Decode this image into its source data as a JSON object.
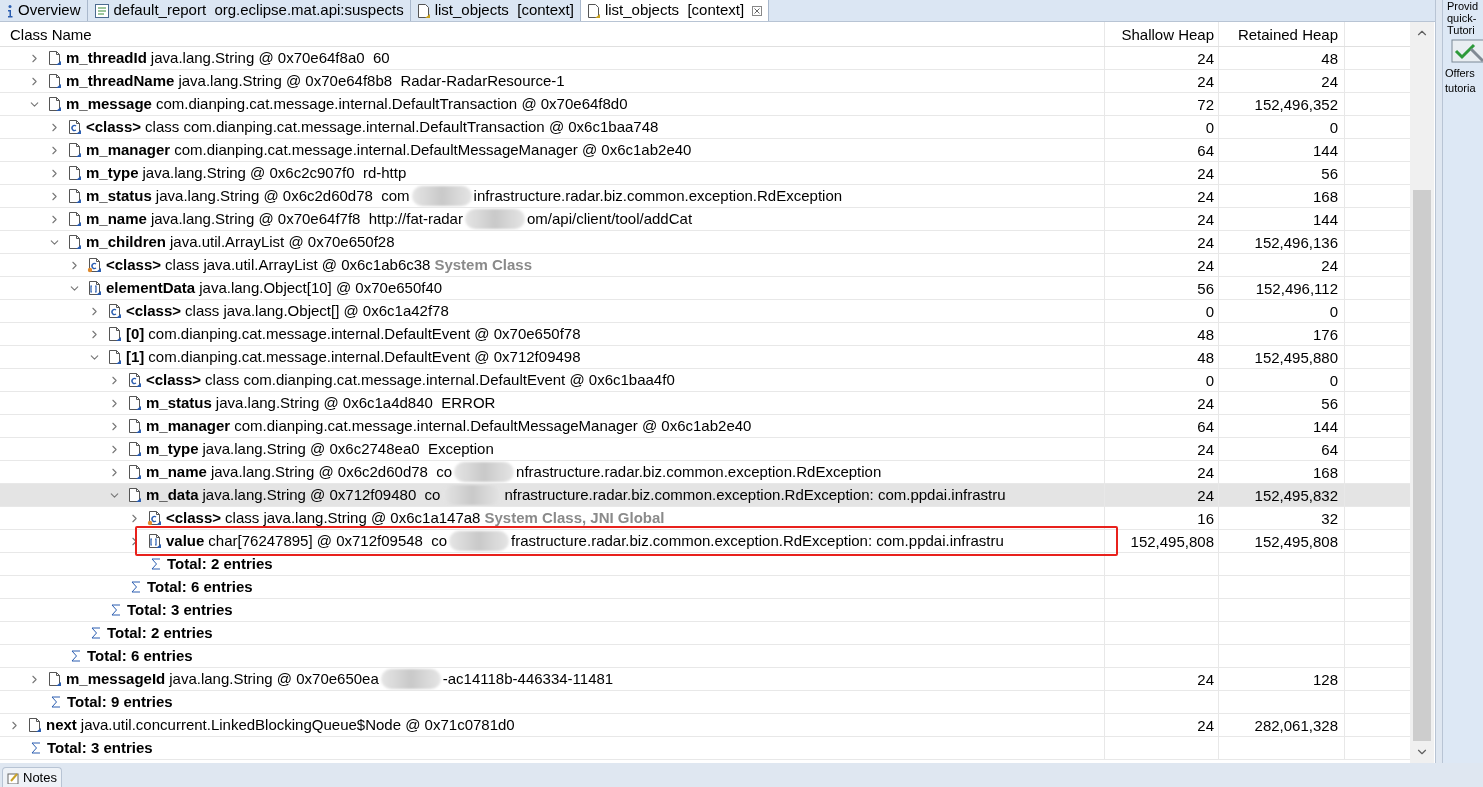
{
  "tabs": [
    {
      "label": "Overview",
      "selected": false
    },
    {
      "label": "default_report  org.eclipse.mat.api:suspects",
      "selected": false
    },
    {
      "label": "list_objects  [context]",
      "selected": false
    },
    {
      "label": "list_objects  [context]",
      "selected": true
    }
  ],
  "columns": [
    "Class Name",
    "Shallow Heap",
    "Retained Heap"
  ],
  "tree": [
    {
      "children": [
        {
          "kind": "field",
          "name": "m_threadId",
          "value": "java.lang.String @ 0x70e64f8a0  60",
          "shallow": "24",
          "retained": "48",
          "expanded": false,
          "selected": false
        },
        {
          "kind": "field",
          "name": "m_threadName",
          "value": "java.lang.String @ 0x70e64f8b8  Radar-RadarResource-1",
          "shallow": "24",
          "retained": "24",
          "expanded": false,
          "selected": false
        },
        {
          "kind": "field",
          "name": "m_message",
          "value": "com.dianping.cat.message.internal.DefaultTransaction @ 0x70e64f8d0",
          "shallow": "72",
          "retained": "152,496,352",
          "expanded": true,
          "selected": false,
          "children": [
            {
              "kind": "class",
              "name": "<class>",
              "value": "class com.dianping.cat.message.internal.DefaultTransaction @ 0x6c1baa748",
              "shallow": "0",
              "retained": "0",
              "expanded": false,
              "selected": false
            },
            {
              "kind": "field",
              "name": "m_manager",
              "value": "com.dianping.cat.message.internal.DefaultMessageManager @ 0x6c1ab2e40",
              "shallow": "64",
              "retained": "144",
              "expanded": false,
              "selected": false
            },
            {
              "kind": "field",
              "name": "m_type",
              "value": "java.lang.String @ 0x6c2c907f0  rd-http",
              "shallow": "24",
              "retained": "56",
              "expanded": false,
              "selected": false
            },
            {
              "kind": "field",
              "name": "m_status",
              "value": "java.lang.String @ 0x6c2d60d78  com",
              "value_tail": "infrastructure.radar.biz.common.exception.RdException",
              "shallow": "24",
              "retained": "168",
              "expanded": false,
              "selected": false
            },
            {
              "kind": "field",
              "name": "m_name",
              "value": "java.lang.String @ 0x70e64f7f8  http://fat-radar",
              "value_tail": "om/api/client/tool/addCat",
              "shallow": "24",
              "retained": "144",
              "expanded": false,
              "selected": false
            },
            {
              "kind": "field",
              "name": "m_children",
              "value": "java.util.ArrayList @ 0x70e650f28",
              "shallow": "24",
              "retained": "152,496,136",
              "expanded": true,
              "selected": false,
              "children": [
                {
                  "kind": "class",
                  "root": true,
                  "name": "<class>",
                  "value": "class java.util.ArrayList @ 0x6c1ab6c38",
                  "note": "System Class",
                  "shallow": "24",
                  "retained": "24",
                  "expanded": false,
                  "selected": false
                },
                {
                  "kind": "array",
                  "name": "elementData",
                  "value": "java.lang.Object[10] @ 0x70e650f40",
                  "shallow": "56",
                  "retained": "152,496,112",
                  "expanded": true,
                  "selected": false,
                  "children": [
                    {
                      "kind": "class",
                      "name": "<class>",
                      "value": "class java.lang.Object[] @ 0x6c1a42f78",
                      "shallow": "0",
                      "retained": "0",
                      "expanded": false,
                      "selected": false
                    },
                    {
                      "kind": "field",
                      "name": "[0]",
                      "value": "com.dianping.cat.message.internal.DefaultEvent @ 0x70e650f78",
                      "shallow": "48",
                      "retained": "176",
                      "expanded": false,
                      "selected": false
                    },
                    {
                      "kind": "field",
                      "name": "[1]",
                      "value": "com.dianping.cat.message.internal.DefaultEvent @ 0x712f09498",
                      "shallow": "48",
                      "retained": "152,495,880",
                      "expanded": true,
                      "selected": false,
                      "children": [
                        {
                          "kind": "class",
                          "name": "<class>",
                          "value": "class com.dianping.cat.message.internal.DefaultEvent @ 0x6c1baa4f0",
                          "shallow": "0",
                          "retained": "0",
                          "expanded": false,
                          "selected": false
                        },
                        {
                          "kind": "field",
                          "name": "m_status",
                          "value": "java.lang.String @ 0x6c1a4d840  ERROR",
                          "shallow": "24",
                          "retained": "56",
                          "expanded": false,
                          "selected": false
                        },
                        {
                          "kind": "field",
                          "name": "m_manager",
                          "value": "com.dianping.cat.message.internal.DefaultMessageManager @ 0x6c1ab2e40",
                          "shallow": "64",
                          "retained": "144",
                          "expanded": false,
                          "selected": false
                        },
                        {
                          "kind": "field",
                          "name": "m_type",
                          "value": "java.lang.String @ 0x6c2748ea0  Exception",
                          "shallow": "24",
                          "retained": "64",
                          "expanded": false,
                          "selected": false
                        },
                        {
                          "kind": "field",
                          "name": "m_name",
                          "value": "java.lang.String @ 0x6c2d60d78  co",
                          "value_tail": "nfrastructure.radar.biz.common.exception.RdException",
                          "shallow": "24",
                          "retained": "168",
                          "expanded": false,
                          "selected": false
                        },
                        {
                          "kind": "field",
                          "name": "m_data",
                          "value": "java.lang.String @ 0x712f09480  co",
                          "value_tail": "nfrastructure.radar.biz.common.exception.RdException: com.ppdai.infrastru",
                          "shallow": "24",
                          "retained": "152,495,832",
                          "expanded": true,
                          "selected": true,
                          "children": [
                            {
                              "kind": "class",
                              "root": true,
                              "name": "<class>",
                              "value": "class java.lang.String @ 0x6c1a147a8",
                              "note": "System Class, JNI Global",
                              "shallow": "16",
                              "retained": "32",
                              "expanded": false,
                              "selected": false
                            },
                            {
                              "kind": "array",
                              "outlined": true,
                              "name": "value",
                              "value": "char[76247895] @ 0x712f09548  co",
                              "value_tail": "frastructure.radar.biz.common.exception.RdException: com.ppdai.infrastru",
                              "shallow": "152,495,808",
                              "retained": "152,495,808",
                              "expanded": false,
                              "selected": false
                            },
                            {
                              "kind": "total",
                              "name": "Total: 2 entries"
                            }
                          ]
                        },
                        {
                          "kind": "total",
                          "name": "Total: 6 entries"
                        }
                      ]
                    },
                    {
                      "kind": "total",
                      "name": "Total: 3 entries"
                    }
                  ]
                },
                {
                  "kind": "total",
                  "name": "Total: 2 entries"
                }
              ]
            },
            {
              "kind": "total",
              "name": "Total: 6 entries"
            }
          ]
        },
        {
          "kind": "field",
          "name": "m_messageId",
          "value": "java.lang.String @ 0x70e650ea",
          "value_tail": "-ac14118b-446334-11481",
          "shallow": "24",
          "retained": "128",
          "expanded": false,
          "selected": false
        },
        {
          "kind": "total",
          "name": "Total: 9 entries"
        }
      ]
    },
    {
      "kind": "field",
      "name": "next",
      "value": "java.util.concurrent.LinkedBlockingQueue$Node @ 0x71c0781d0",
      "shallow": "24",
      "retained": "282,061,328",
      "expanded": false,
      "selected": false
    },
    {
      "kind": "total",
      "name": "Total: 3 entries"
    }
  ],
  "side_panel": {
    "lines_top": [
      "Provid",
      "quick-",
      "Tutori"
    ],
    "lines_bottom": [
      "Offers",
      "tutoria"
    ]
  },
  "bottom_tab": {
    "label": "Notes"
  }
}
